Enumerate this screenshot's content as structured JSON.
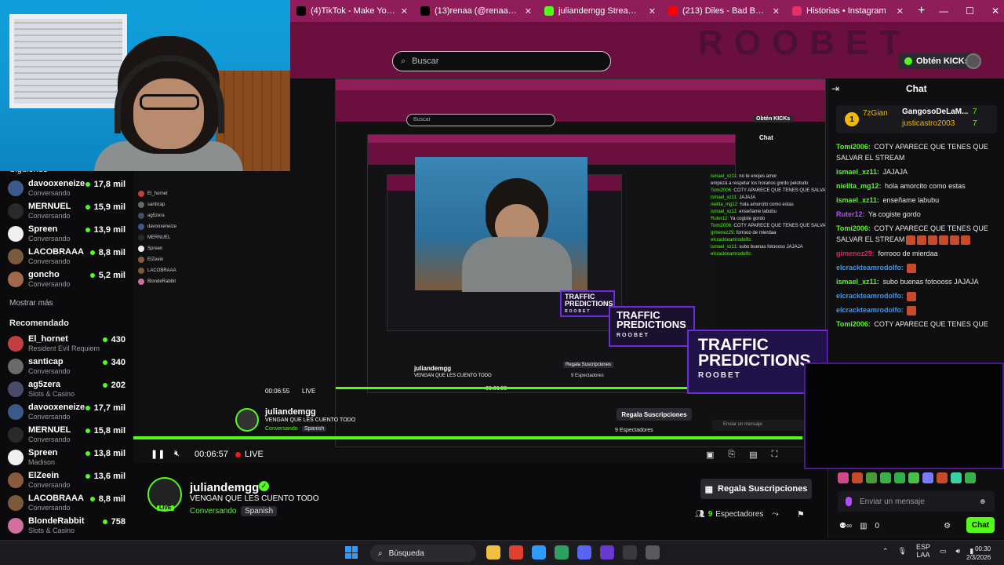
{
  "browser": {
    "tabs": [
      {
        "title": "(4)TikTok - Make Your Day",
        "icon": "tiktok-icon",
        "color": "#000000"
      },
      {
        "title": "(13)renaa (@renaagulino) | TikTok",
        "icon": "tiktok-icon",
        "color": "#000000"
      },
      {
        "title": "juliandemgg Stream - Watch Live",
        "icon": "kick-icon",
        "color": "#53fc18"
      },
      {
        "title": "(213) Diles - Bad Bunny, Ozuna",
        "icon": "youtube-icon",
        "color": "#ff0000"
      },
      {
        "title": "Historias • Instagram",
        "icon": "instagram-icon",
        "color": "#e1306c"
      }
    ],
    "new_tab": "+",
    "win_controls": [
      "—",
      "☐",
      "✕"
    ]
  },
  "header": {
    "search_placeholder": "Buscar",
    "kicks_label": "Obtén KICKs",
    "roobet_watermark": "ROOBET"
  },
  "sidebar": {
    "following_heading": "Siguiendo",
    "following": [
      {
        "name": "davooxeneize",
        "category": "Conversando",
        "viewers": "17,8 mil",
        "avatar_color": "#3b5a8a"
      },
      {
        "name": "MERNUEL",
        "category": "Conversando",
        "viewers": "15,9 mil",
        "avatar_color": "#2a2a2a"
      },
      {
        "name": "Spreen",
        "category": "Conversando",
        "viewers": "13,9 mil",
        "avatar_color": "#f0f0f0"
      },
      {
        "name": "LACOBRAAA",
        "category": "Conversando",
        "viewers": "8,8 mil",
        "avatar_color": "#7a5a3a"
      },
      {
        "name": "goncho",
        "category": "Conversando",
        "viewers": "5,2 mil",
        "avatar_color": "#a06a4a"
      }
    ],
    "show_more": "Mostrar más",
    "recommended_heading": "Recomendado",
    "recommended": [
      {
        "name": "El_hornet",
        "category": "Resident Evil Requiem",
        "viewers": "430",
        "avatar_color": "#c04040"
      },
      {
        "name": "santicap",
        "category": "Conversando",
        "viewers": "340",
        "avatar_color": "#6a6a6a"
      },
      {
        "name": "ag5zera",
        "category": "Slots & Casino",
        "viewers": "202",
        "avatar_color": "#4a4a6a"
      },
      {
        "name": "davooxeneize",
        "category": "Conversando",
        "viewers": "17,7 mil",
        "avatar_color": "#3b5a8a"
      },
      {
        "name": "MERNUEL",
        "category": "Conversando",
        "viewers": "15,8 mil",
        "avatar_color": "#2a2a2a"
      },
      {
        "name": "Spreen",
        "category": "Madison",
        "viewers": "13,8 mil",
        "avatar_color": "#f0f0f0"
      },
      {
        "name": "ElZeein",
        "category": "Conversando",
        "viewers": "13,6 mil",
        "avatar_color": "#8a5a3a"
      },
      {
        "name": "LACOBRAAA",
        "category": "Conversando",
        "viewers": "8,8 mil",
        "avatar_color": "#7a5a3a"
      },
      {
        "name": "BlondeRabbit",
        "category": "Slots & Casino",
        "viewers": "758",
        "avatar_color": "#d070a0"
      }
    ]
  },
  "ads": {
    "line1": "TRAFFIC",
    "line2": "PREDICTIONS",
    "brand": "ROOBET"
  },
  "nested": {
    "search": "Buscar",
    "kicks": "Obtén KICKs",
    "chat_title": "Chat",
    "streamer": "juliandemgg",
    "title": "VENGAN QUE LES CUENTO TODO",
    "category": "Conversando",
    "language": "Spanish",
    "subs_label": "Regala Suscripciones",
    "viewers": "9 Espectadores",
    "time": "00:06:55",
    "live": "LIVE",
    "chat_input": "Enviar un mensaje",
    "mini_lines": [
      [
        "ismael_xz11:",
        " no te enojes amor"
      ],
      [
        "",
        "empezá a respetar los horarios gordo pelotudo"
      ],
      [
        "Tomi2006:",
        " COTY APARECE QUE TENES QUE SALVAR EL STREAM"
      ],
      [
        "ismael_xz11:",
        " JAJAJA"
      ],
      [
        "niellta_mg12:",
        " hola amorcito como estas"
      ],
      [
        "ismael_xz11:",
        " enseñame labubu"
      ],
      [
        "Ruter12:",
        " Ya cogiste gordo"
      ],
      [
        "Tomi2006:",
        " COTY APARECE QUE TENES QUE SALVAR EL STREAM"
      ],
      [
        "gimenez29:",
        " forrooo de mierdaa"
      ],
      [
        "elcrackteamrodolfo:",
        ""
      ],
      [
        "ismael_xz11:",
        " subo buenas fotoooss JAJAJA"
      ],
      [
        "elcrackteamrodolfo:",
        ""
      ]
    ]
  },
  "player": {
    "progress": 0.998,
    "time": "00:06:57",
    "live_label": "LIVE"
  },
  "stream": {
    "streamer": "juliandemgg",
    "live_badge": "LIVE",
    "title": "VENGAN QUE LES CUENTO TODO",
    "category": "Conversando",
    "language": "Spanish",
    "gift_label": "Regala Suscripciones",
    "viewer_count": "9",
    "viewer_label": "Espectadores"
  },
  "chat": {
    "title": "Chat",
    "pinned": {
      "top_gifter": "7zGian",
      "rank_badge": "1",
      "second": "GangosoDeLaM...",
      "second_count": "7",
      "third": "justicastro2003",
      "third_count": "7"
    },
    "messages": [
      {
        "user": "Tomi2006:",
        "color": "#53fc18",
        "text": " COTY APARECE QUE TENES QUE SALVAR EL STREAM",
        "emotes": 0
      },
      {
        "user": "ismael_xz11:",
        "color": "#53fc18",
        "text": " JAJAJA",
        "emotes": 0
      },
      {
        "user": "niellta_mg12:",
        "color": "#53fc18",
        "text": " hola amorcito como estas",
        "emotes": 0
      },
      {
        "user": "ismael_xz11:",
        "color": "#53fc18",
        "text": " enseñame labubu",
        "emotes": 0
      },
      {
        "user": "Ruter12:",
        "color": "#b34dff",
        "text": " Ya cogiste gordo",
        "emotes": 0
      },
      {
        "user": "Tomi2006:",
        "color": "#53fc18",
        "text": " COTY APARECE QUE TENES QUE SALVAR EL STREAM",
        "emotes": 6
      },
      {
        "user": "gimenez29:",
        "color": "#e0245e",
        "text": " forrooo de mierdaa",
        "emotes": 0
      },
      {
        "user": "elcrackteamrodolfo:",
        "color": "#2f9bff",
        "text": "",
        "emotes": 1
      },
      {
        "user": "ismael_xz11:",
        "color": "#53fc18",
        "text": " subo buenas fotoooss JAJAJA",
        "emotes": 0
      },
      {
        "user": "elcrackteamrodolfo:",
        "color": "#2f9bff",
        "text": "",
        "emotes": 1
      },
      {
        "user": "elcrackteamrodolfo:",
        "color": "#2f9bff",
        "text": "",
        "emotes": 1
      },
      {
        "user": "Tomi2006:",
        "color": "#53fc18",
        "text": " COTY APARECE QUE TENES QUE",
        "emotes": 0
      }
    ],
    "input_placeholder": "Enviar un mensaje",
    "points": "0",
    "send_label": "Chat",
    "emote_colors": [
      "#d04a8a",
      "#c64b2a",
      "#4a9a3a",
      "#3ab04a",
      "#2fb04a",
      "#4ac04a",
      "#7a7aff",
      "#c64b2a",
      "#3ad0a0",
      "#3ab04a"
    ]
  },
  "taskbar": {
    "search_label": "Búsqueda",
    "lang_top": "ESP",
    "lang_bottom": "LAA",
    "time": "00:30",
    "date": "2/3/2026",
    "apps": [
      {
        "name": "file-explorer-icon",
        "color": "#f0c040"
      },
      {
        "name": "chrome-icon",
        "color": "#e04030"
      },
      {
        "name": "edge-icon",
        "color": "#2f9bff"
      },
      {
        "name": "chrome-app-icon",
        "color": "#30a060"
      },
      {
        "name": "discord-icon",
        "color": "#5865f2"
      },
      {
        "name": "obs-icon",
        "color": "#6a3ad0"
      },
      {
        "name": "media-player-icon",
        "color": "#3a3a3a"
      },
      {
        "name": "settings-icon",
        "color": "#5a5a5a"
      }
    ]
  }
}
